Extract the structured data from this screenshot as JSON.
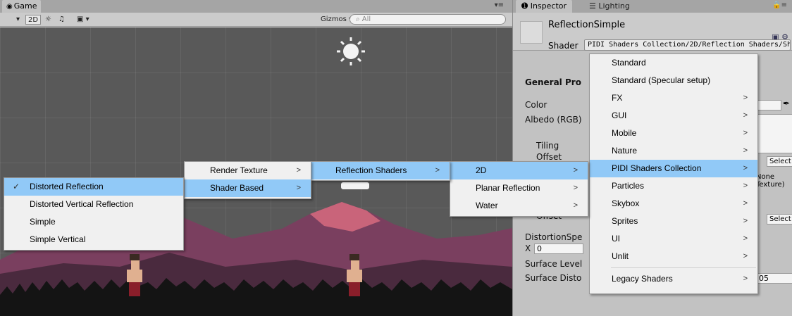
{
  "game": {
    "tab_label": "Game",
    "tab_icon": "game-controller-icon",
    "toolbar": {
      "mode_2d": "2D",
      "gizmos": "Gizmos",
      "search_placeholder": "All"
    }
  },
  "inspector": {
    "tab_inspector": "Inspector",
    "tab_lighting": "Lighting",
    "material_name": "ReflectionSimple",
    "shader_label": "Shader",
    "shader_value": "PIDI Shaders Collection/2D/Reflection Shaders/Sh",
    "props": {
      "general_title": "General Pro",
      "color": "Color",
      "albedo": "Albedo (RGB)",
      "tiling": "Tiling",
      "offset": "Offset",
      "offset2": "Offset",
      "select1": "Select",
      "select2": "Select",
      "none_texture_1": "None",
      "none_texture_2": "Texture)",
      "distortion_speed": "DistortionSpe",
      "x_label": "X",
      "x_value": "0",
      "surface_level": "Surface Level",
      "surface_disto": "Surface Disto",
      "surface_disto_value": "05"
    }
  },
  "menus": {
    "shader_root": [
      {
        "label": "Standard",
        "arrow": false
      },
      {
        "label": "Standard (Specular setup)",
        "arrow": false
      },
      {
        "label": "FX",
        "arrow": true
      },
      {
        "label": "GUI",
        "arrow": true
      },
      {
        "label": "Mobile",
        "arrow": true
      },
      {
        "label": "Nature",
        "arrow": true
      },
      {
        "label": "PIDI Shaders Collection",
        "arrow": true,
        "highlight": true
      },
      {
        "label": "Particles",
        "arrow": true
      },
      {
        "label": "Skybox",
        "arrow": true
      },
      {
        "label": "Sprites",
        "arrow": true
      },
      {
        "label": "UI",
        "arrow": true
      },
      {
        "label": "Unlit",
        "arrow": true
      },
      {
        "label": "Legacy Shaders",
        "arrow": true
      }
    ],
    "pidi": [
      {
        "label": "2D",
        "arrow": true,
        "highlight": true
      },
      {
        "label": "Planar Reflection",
        "arrow": true
      },
      {
        "label": "Water",
        "arrow": true
      }
    ],
    "twod": [
      {
        "label": "Reflection Shaders",
        "arrow": true,
        "highlight": true
      }
    ],
    "reflection": [
      {
        "label": "Render Texture",
        "arrow": true
      },
      {
        "label": "Shader Based",
        "arrow": true,
        "highlight": true
      }
    ],
    "shader_based": [
      {
        "label": "Distorted Reflection",
        "checked": true,
        "highlight": true
      },
      {
        "label": "Distorted Vertical Reflection"
      },
      {
        "label": "Simple"
      },
      {
        "label": "Simple Vertical"
      }
    ],
    "arrow_glyph": ">",
    "check_glyph": "✓"
  },
  "colors": {
    "highlight": "#91c9f7",
    "sky": "#595959",
    "mountain_back": "#7a3f5f",
    "mountain_peak": "#c9647a",
    "mountain_front": "#4a2a3e",
    "forest": "#141414"
  }
}
